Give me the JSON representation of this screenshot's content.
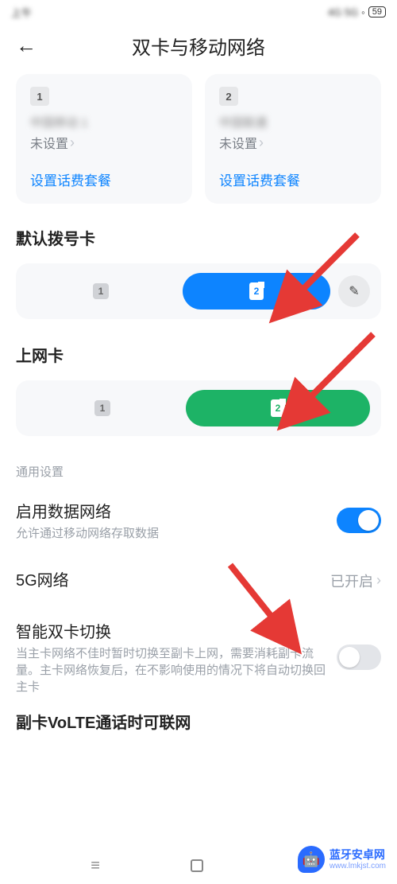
{
  "status": {
    "left_blur": "上午",
    "right_blur": "4G 5G",
    "battery": "59"
  },
  "header": {
    "title": "双卡与移动网络"
  },
  "sim_cards": [
    {
      "num": "1",
      "carrier_blur": "中国移动 1",
      "status": "未设置",
      "link": "设置话费套餐"
    },
    {
      "num": "2",
      "carrier_blur": "中国联通",
      "status": "未设置",
      "link": "设置话费套餐"
    }
  ],
  "default_dial": {
    "title": "默认拨号卡",
    "opt1": "1",
    "opt2": "2",
    "edit": "✎"
  },
  "data_sim": {
    "title": "上网卡",
    "opt1": "1",
    "opt2": "2"
  },
  "general": {
    "subhead": "通用设置",
    "enable_data": {
      "title": "启用数据网络",
      "sub": "允许通过移动网络存取数据"
    },
    "five_g": {
      "title": "5G网络",
      "value": "已开启"
    },
    "smart_switch": {
      "title": "智能双卡切换",
      "sub": "当主卡网络不佳时暂时切换至副卡上网，需要消耗副卡流量。主卡网络恢复后，在不影响使用的情况下将自动切换回主卡"
    },
    "volte_cutoff": "副卡VoLTE通话时可联网"
  },
  "watermark": {
    "name": "蓝牙安卓网",
    "url": "www.lmkjst.com"
  }
}
